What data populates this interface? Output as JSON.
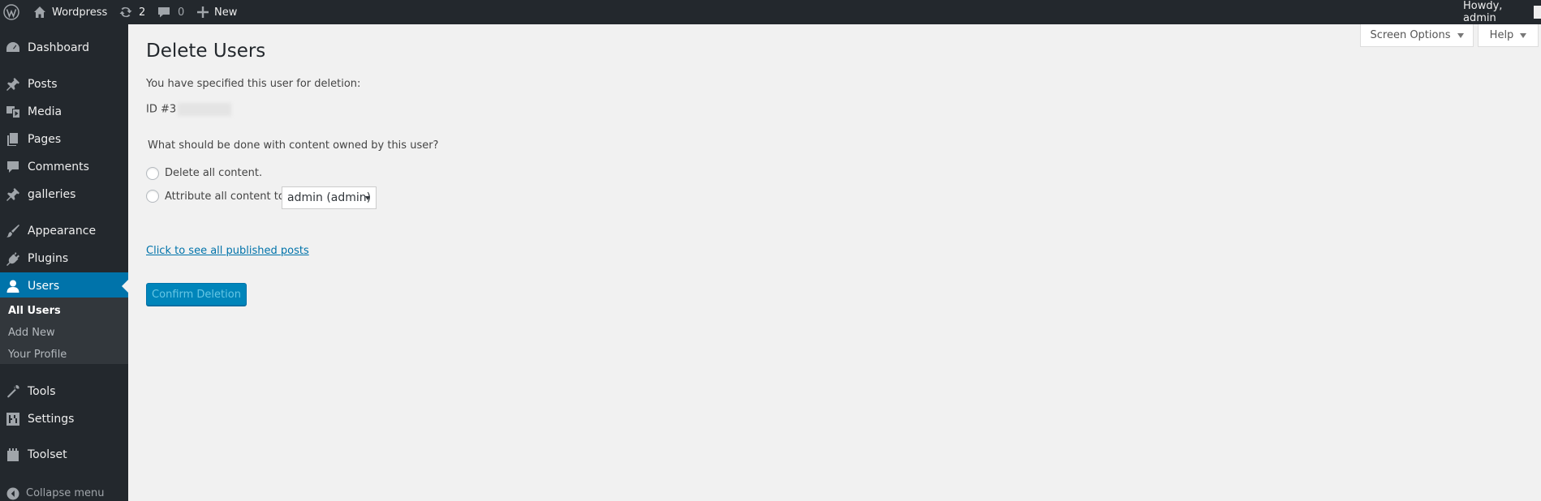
{
  "adminbar": {
    "site_name": "Wordpress",
    "updates_count": "2",
    "comments_count": "0",
    "new_label": "New",
    "greeting": "Howdy, admin"
  },
  "sidebar": {
    "items": [
      {
        "label": "Dashboard",
        "icon": "dashboard-icon"
      },
      {
        "label": "Posts",
        "icon": "pushpin-icon"
      },
      {
        "label": "Media",
        "icon": "media-icon"
      },
      {
        "label": "Pages",
        "icon": "pages-icon"
      },
      {
        "label": "Comments",
        "icon": "comment-icon"
      },
      {
        "label": "galleries",
        "icon": "pushpin-icon"
      },
      {
        "label": "Appearance",
        "icon": "paintbrush-icon"
      },
      {
        "label": "Plugins",
        "icon": "plug-icon"
      },
      {
        "label": "Users",
        "icon": "user-icon"
      },
      {
        "label": "Tools",
        "icon": "wrench-icon"
      },
      {
        "label": "Settings",
        "icon": "settings-icon"
      },
      {
        "label": "Toolset",
        "icon": "toolset-icon"
      }
    ],
    "submenu": [
      "All Users",
      "Add New",
      "Your Profile"
    ],
    "collapse_label": "Collapse menu"
  },
  "screen_meta": {
    "screen_options_label": "Screen Options",
    "help_label": "Help"
  },
  "main": {
    "title": "Delete Users",
    "specified_text": "You have specified this user for deletion:",
    "user_id": "ID #3",
    "question": "What should be done with content owned by this user?",
    "option_delete": "Delete all content.",
    "option_attribute": "Attribute all content to:",
    "attribute_select_value": "admin (admin)",
    "posts_link": "Click to see all published posts",
    "confirm_button": "Confirm Deletion"
  },
  "colors": {
    "admin_bar_bg": "#23282d",
    "menu_current_bg": "#0073aa",
    "primary_button": "#0085ba",
    "page_bg": "#f1f1f1"
  }
}
